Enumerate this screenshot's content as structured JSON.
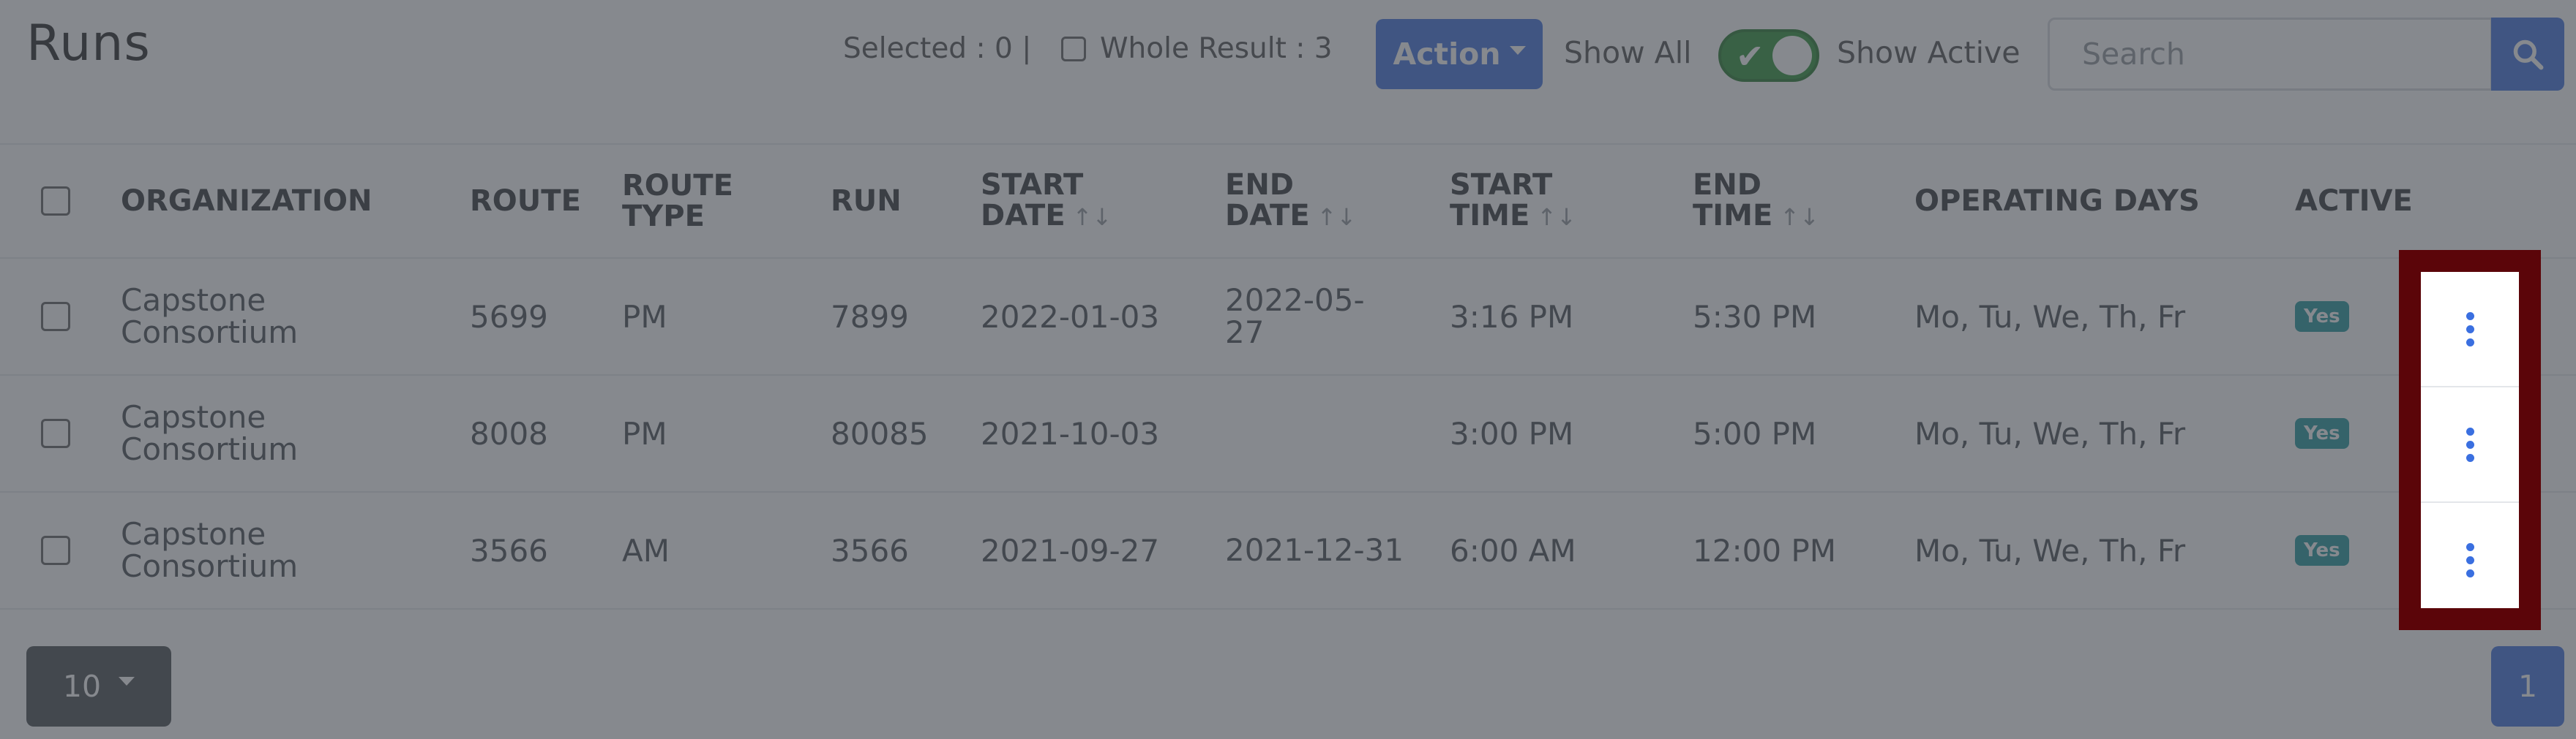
{
  "header": {
    "title": "Runs",
    "selected_text": "Selected : 0 |",
    "whole_result_text": "Whole Result : 3",
    "action_label": "Action",
    "show_all_label": "Show All",
    "show_active_label": "Show Active",
    "search_placeholder": "Search",
    "toggle_checked": true
  },
  "table": {
    "columns": [
      {
        "label": "ORGANIZATION"
      },
      {
        "label": "ROUTE"
      },
      {
        "label_line1": "ROUTE",
        "label_line2": "TYPE"
      },
      {
        "label": "RUN"
      },
      {
        "label_line1": "START",
        "label_line2": "DATE",
        "sortable": true
      },
      {
        "label_line1": "END",
        "label_line2": "DATE",
        "sortable": true
      },
      {
        "label_line1": "START",
        "label_line2": "TIME",
        "sortable": true
      },
      {
        "label_line1": "END",
        "label_line2": "TIME",
        "sortable": true
      },
      {
        "label": "OPERATING DAYS"
      },
      {
        "label": "ACTIVE"
      }
    ],
    "sort_glyph": "↑↓",
    "rows": [
      {
        "org_line1": "Capstone",
        "org_line2": "Consortium",
        "route": "5699",
        "route_type": "PM",
        "run": "7899",
        "start_date": "2022-01-03",
        "end_date_line1": "2022-05-",
        "end_date_line2": "27",
        "start_time": "3:16 PM",
        "end_time": "5:30 PM",
        "operating_days": "Mo, Tu, We, Th, Fr",
        "active": "Yes"
      },
      {
        "org_line1": "Capstone",
        "org_line2": "Consortium",
        "route": "8008",
        "route_type": "PM",
        "run": "80085",
        "start_date": "2021-10-03",
        "end_date_line1": "",
        "end_date_line2": "",
        "start_time": "3:00 PM",
        "end_time": "5:00 PM",
        "operating_days": "Mo, Tu, We, Th, Fr",
        "active": "Yes"
      },
      {
        "org_line1": "Capstone",
        "org_line2": "Consortium",
        "route": "3566",
        "route_type": "AM",
        "run": "3566",
        "start_date": "2021-09-27",
        "end_date_line1": "2021-12-31",
        "end_date_line2": "",
        "start_time": "6:00 AM",
        "end_time": "12:00 PM",
        "operating_days": "Mo, Tu, We, Th, Fr",
        "active": "Yes"
      }
    ]
  },
  "footer": {
    "page_size": "10",
    "current_page": "1"
  },
  "colors": {
    "primary": "#3468dc",
    "toggle_on": "#1f8a2a",
    "badge": "#138f96",
    "highlight": "#5b0509",
    "overlay": "#484c54"
  }
}
